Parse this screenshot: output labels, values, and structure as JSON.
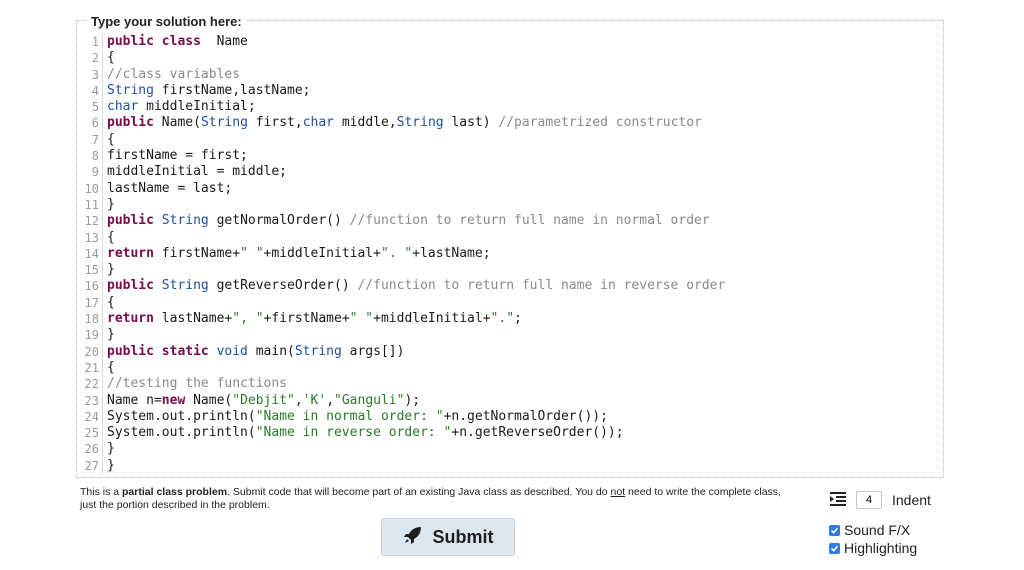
{
  "editor": {
    "title": "Type your solution here:",
    "lines": [
      [
        [
          "kw",
          "public class"
        ],
        [
          "",
          "  Name"
        ]
      ],
      [
        [
          "",
          "{"
        ]
      ],
      [
        [
          "cm",
          "//class variables"
        ]
      ],
      [
        [
          "ty",
          "String"
        ],
        [
          "",
          " firstName,lastName;"
        ]
      ],
      [
        [
          "ty",
          "char"
        ],
        [
          "",
          " middleInitial;"
        ]
      ],
      [
        [
          "kw",
          "public"
        ],
        [
          "",
          " Name("
        ],
        [
          "ty",
          "String"
        ],
        [
          "",
          " first,"
        ],
        [
          "ty",
          "char"
        ],
        [
          "",
          " middle,"
        ],
        [
          "ty",
          "String"
        ],
        [
          "",
          " last) "
        ],
        [
          "cm",
          "//parametrized constructor"
        ]
      ],
      [
        [
          "",
          "{"
        ]
      ],
      [
        [
          "",
          "firstName = first;"
        ]
      ],
      [
        [
          "",
          "middleInitial = middle;"
        ]
      ],
      [
        [
          "",
          "lastName = last;"
        ]
      ],
      [
        [
          "",
          "}"
        ]
      ],
      [
        [
          "kw",
          "public"
        ],
        [
          "",
          " "
        ],
        [
          "ty",
          "String"
        ],
        [
          "",
          " getNormalOrder() "
        ],
        [
          "cm",
          "//function to return full name in normal order"
        ]
      ],
      [
        [
          "",
          "{"
        ]
      ],
      [
        [
          "kw",
          "return"
        ],
        [
          "",
          " firstName+"
        ],
        [
          "st",
          "\" \""
        ],
        [
          "",
          "+middleInitial+"
        ],
        [
          "st",
          "\". \""
        ],
        [
          "",
          "+lastName;"
        ]
      ],
      [
        [
          "",
          "}"
        ]
      ],
      [
        [
          "kw",
          "public"
        ],
        [
          "",
          " "
        ],
        [
          "ty",
          "String"
        ],
        [
          "",
          " getReverseOrder() "
        ],
        [
          "cm",
          "//function to return full name in reverse order"
        ]
      ],
      [
        [
          "",
          "{"
        ]
      ],
      [
        [
          "kw",
          "return"
        ],
        [
          "",
          " lastName+"
        ],
        [
          "st",
          "\", \""
        ],
        [
          "",
          "+firstName+"
        ],
        [
          "st",
          "\" \""
        ],
        [
          "",
          "+middleInitial+"
        ],
        [
          "st",
          "\".\""
        ],
        [
          "",
          ";"
        ]
      ],
      [
        [
          "",
          "}"
        ]
      ],
      [
        [
          "kw",
          "public static"
        ],
        [
          "",
          " "
        ],
        [
          "ty",
          "void"
        ],
        [
          "",
          " main("
        ],
        [
          "ty",
          "String"
        ],
        [
          "",
          " args[])"
        ]
      ],
      [
        [
          "",
          "{"
        ]
      ],
      [
        [
          "cm",
          "//testing the functions"
        ]
      ],
      [
        [
          "",
          "Name n="
        ],
        [
          "kw",
          "new"
        ],
        [
          "",
          " Name("
        ],
        [
          "st",
          "\"Debjit\""
        ],
        [
          "",
          ","
        ],
        [
          "st",
          "'K'"
        ],
        [
          "",
          ","
        ],
        [
          "st",
          "\"Ganguli\""
        ],
        [
          "",
          ");"
        ]
      ],
      [
        [
          "",
          "System.out.println("
        ],
        [
          "st",
          "\"Name in normal order: \""
        ],
        [
          "",
          "+n.getNormalOrder());"
        ]
      ],
      [
        [
          "",
          "System.out.println("
        ],
        [
          "st",
          "\"Name in reverse order: \""
        ],
        [
          "",
          "+n.getReverseOrder());"
        ]
      ],
      [
        [
          "",
          "}"
        ]
      ],
      [
        [
          "",
          "}"
        ]
      ]
    ]
  },
  "hint": {
    "part1": "This is a ",
    "strong": "partial class problem",
    "part2": ". Submit code that will become part of an existing Java class as described. You do ",
    "underline": "not",
    "part3": " need to write the complete class, just the portion described in the problem."
  },
  "submit": {
    "label": "Submit",
    "icon": "rocket-icon"
  },
  "indent": {
    "value": "4",
    "label": "Indent",
    "icon": "indent-icon"
  },
  "options": [
    {
      "label": "Sound F/X",
      "checked": true
    },
    {
      "label": "Highlighting",
      "checked": true
    }
  ],
  "colors": {
    "keyword": "#7a0b4b",
    "type": "#1f4f9d",
    "string": "#2a7a2a",
    "comment": "#8a8a8a",
    "checkbox": "#2f7be0",
    "button_bg": "#dde7ef"
  }
}
